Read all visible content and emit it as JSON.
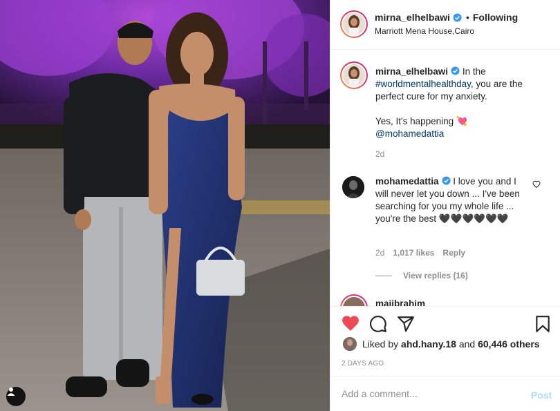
{
  "post": {
    "author": "mirna_elhelbawi",
    "follow_status": "Following",
    "dot": "•",
    "location": "Marriott Mena House,Cairo"
  },
  "caption": {
    "username": "mirna_elhelbawi",
    "text_before": "In the",
    "hashtag": "#worldmentalhealthday",
    "text_after": ", you are the perfect cure for my anxiety.",
    "line2": "Yes, It's happening 💘",
    "mention": "@mohamedattia",
    "time": "2d"
  },
  "comment": {
    "username": "mohamedattia",
    "text": "I love you and I will never let you down ... I've been searching for you my whole life ... you're the best 🖤🖤🖤🖤🖤🖤",
    "time": "2d",
    "likes": "1,017 likes",
    "reply": "Reply",
    "view_replies": "View replies (16)"
  },
  "next_comment": {
    "username": "maiibrahim"
  },
  "likes": {
    "prefix": "Liked by",
    "user": "ahd.hany.18",
    "middle": "and",
    "count": "60,446 others"
  },
  "date": "2 DAYS AGO",
  "comment_box": {
    "placeholder": "Add a comment...",
    "post_label": "Post"
  },
  "icons": {
    "like": "heart-filled-icon",
    "comment": "comment-bubble-icon",
    "share": "paper-plane-icon",
    "save": "bookmark-icon",
    "verified": "verified-badge-icon",
    "user_tag": "person-icon"
  },
  "colors": {
    "like_red": "#ed4956",
    "link_blue": "#00376b",
    "verified_blue": "#3897f0",
    "post_disabled": "#b3dbff"
  }
}
